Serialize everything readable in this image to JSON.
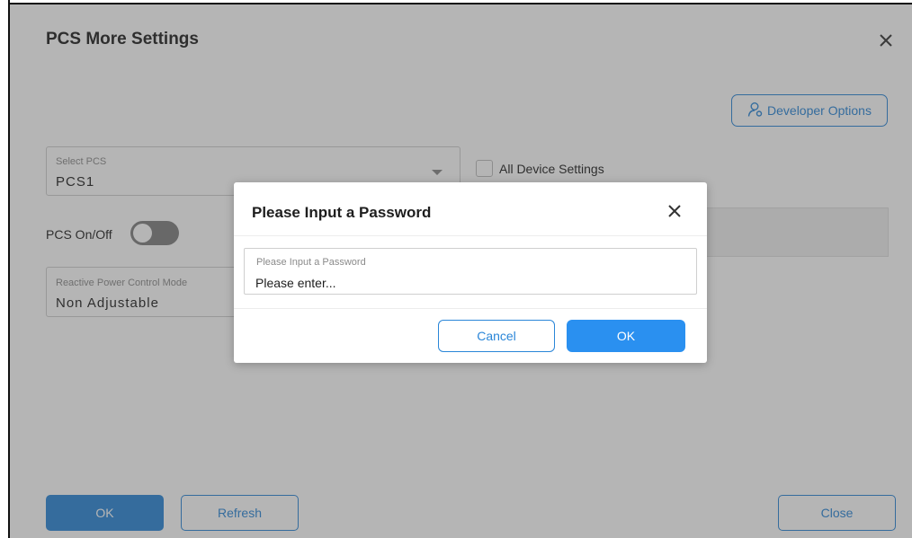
{
  "main": {
    "title": "PCS More Settings",
    "developer_options_label": "Developer Options",
    "select_pcs": {
      "label": "Select PCS",
      "value": "PCS1"
    },
    "all_device_settings_label": "All Device Settings",
    "pcs_onoff_label": "PCS On/Off",
    "pcs_onoff_state": "off",
    "reactive_power": {
      "label": "Reactive Power Control Mode",
      "value": "Non Adjustable"
    },
    "buttons": {
      "ok": "OK",
      "refresh": "Refresh",
      "close": "Close"
    }
  },
  "dialog": {
    "title": "Please Input a Password",
    "input_label": "Please Input a Password",
    "input_placeholder": "Please enter...",
    "cancel_label": "Cancel",
    "ok_label": "OK"
  },
  "colors": {
    "accent": "#2a86d8",
    "dialog_ok": "#2a90f0",
    "overlay": "rgba(70,70,70,0.40)"
  },
  "icons": {
    "close": "close-icon",
    "developer": "user-icon",
    "dropdown": "chevron-down-icon"
  }
}
